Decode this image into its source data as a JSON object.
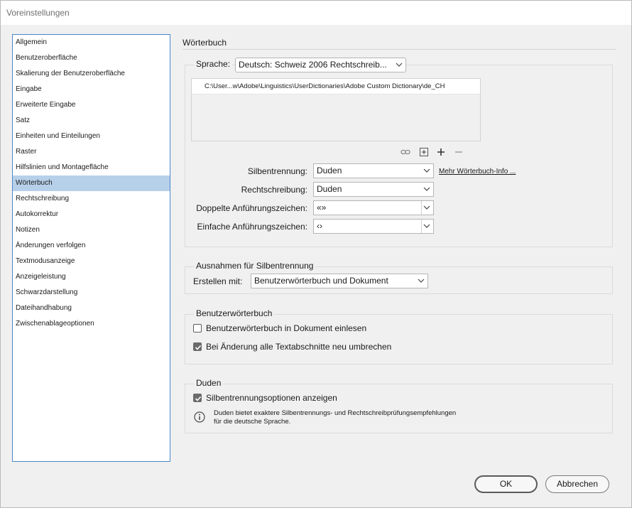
{
  "window": {
    "title": "Voreinstellungen"
  },
  "sidebar": {
    "items": [
      {
        "label": "Allgemein"
      },
      {
        "label": "Benutzeroberfläche"
      },
      {
        "label": "Skalierung der Benutzeroberfläche"
      },
      {
        "label": "Eingabe"
      },
      {
        "label": "Erweiterte Eingabe"
      },
      {
        "label": "Satz"
      },
      {
        "label": "Einheiten und Einteilungen"
      },
      {
        "label": "Raster"
      },
      {
        "label": "Hilfslinien und Montagefläche"
      },
      {
        "label": "Wörterbuch",
        "selected": true
      },
      {
        "label": "Rechtschreibung"
      },
      {
        "label": "Autokorrektur"
      },
      {
        "label": "Notizen"
      },
      {
        "label": "Änderungen verfolgen"
      },
      {
        "label": "Textmodusanzeige"
      },
      {
        "label": "Anzeigeleistung"
      },
      {
        "label": "Schwarzdarstellung"
      },
      {
        "label": "Dateihandhabung"
      },
      {
        "label": "Zwischenablageoptionen"
      }
    ]
  },
  "main": {
    "title": "Wörterbuch",
    "language": {
      "label": "Sprache:",
      "value": "Deutsch: Schweiz 2006 Rechtschreib..."
    },
    "dictionary_paths": [
      "C:\\User...w\\Adobe\\Linguistics\\UserDictionaries\\Adobe Custom Dictionary\\de_CH"
    ],
    "toolbar_icons": [
      "link-icon",
      "add-box-icon",
      "plus-icon",
      "minus-icon"
    ],
    "hyphenation": {
      "label": "Silbentrennung:",
      "value": "Duden"
    },
    "more_info_link": "Mehr Wörterbuch-Info ...",
    "spelling": {
      "label": "Rechtschreibung:",
      "value": "Duden"
    },
    "double_quotes": {
      "label": "Doppelte Anführungszeichen:",
      "value": "«»"
    },
    "single_quotes": {
      "label": "Einfache Anführungszeichen:",
      "value": "‹›"
    },
    "exceptions": {
      "title": "Ausnahmen für Silbentrennung",
      "compose_label": "Erstellen mit:",
      "compose_value": "Benutzerwörterbuch und Dokument"
    },
    "user_dictionary": {
      "title": "Benutzerwörterbuch",
      "merge_into_document": {
        "label": "Benutzerwörterbuch in Dokument einlesen",
        "checked": false
      },
      "recompose_all": {
        "label": "Bei Änderung alle Textabschnitte neu umbrechen",
        "checked": true
      }
    },
    "duden": {
      "title": "Duden",
      "show_options": {
        "label": "Silbentrennungsoptionen anzeigen",
        "checked": true
      },
      "info_line1": "Duden bietet exaktere Silbentrennungs- und Rechtschreibprüfungsempfehlungen",
      "info_line2": "für die deutsche Sprache."
    }
  },
  "buttons": {
    "ok": "OK",
    "cancel": "Abbrechen"
  },
  "colors": {
    "selection": "#b7d0ea",
    "sidebar_border": "#4a86c8",
    "background": "#f0f0f0"
  }
}
